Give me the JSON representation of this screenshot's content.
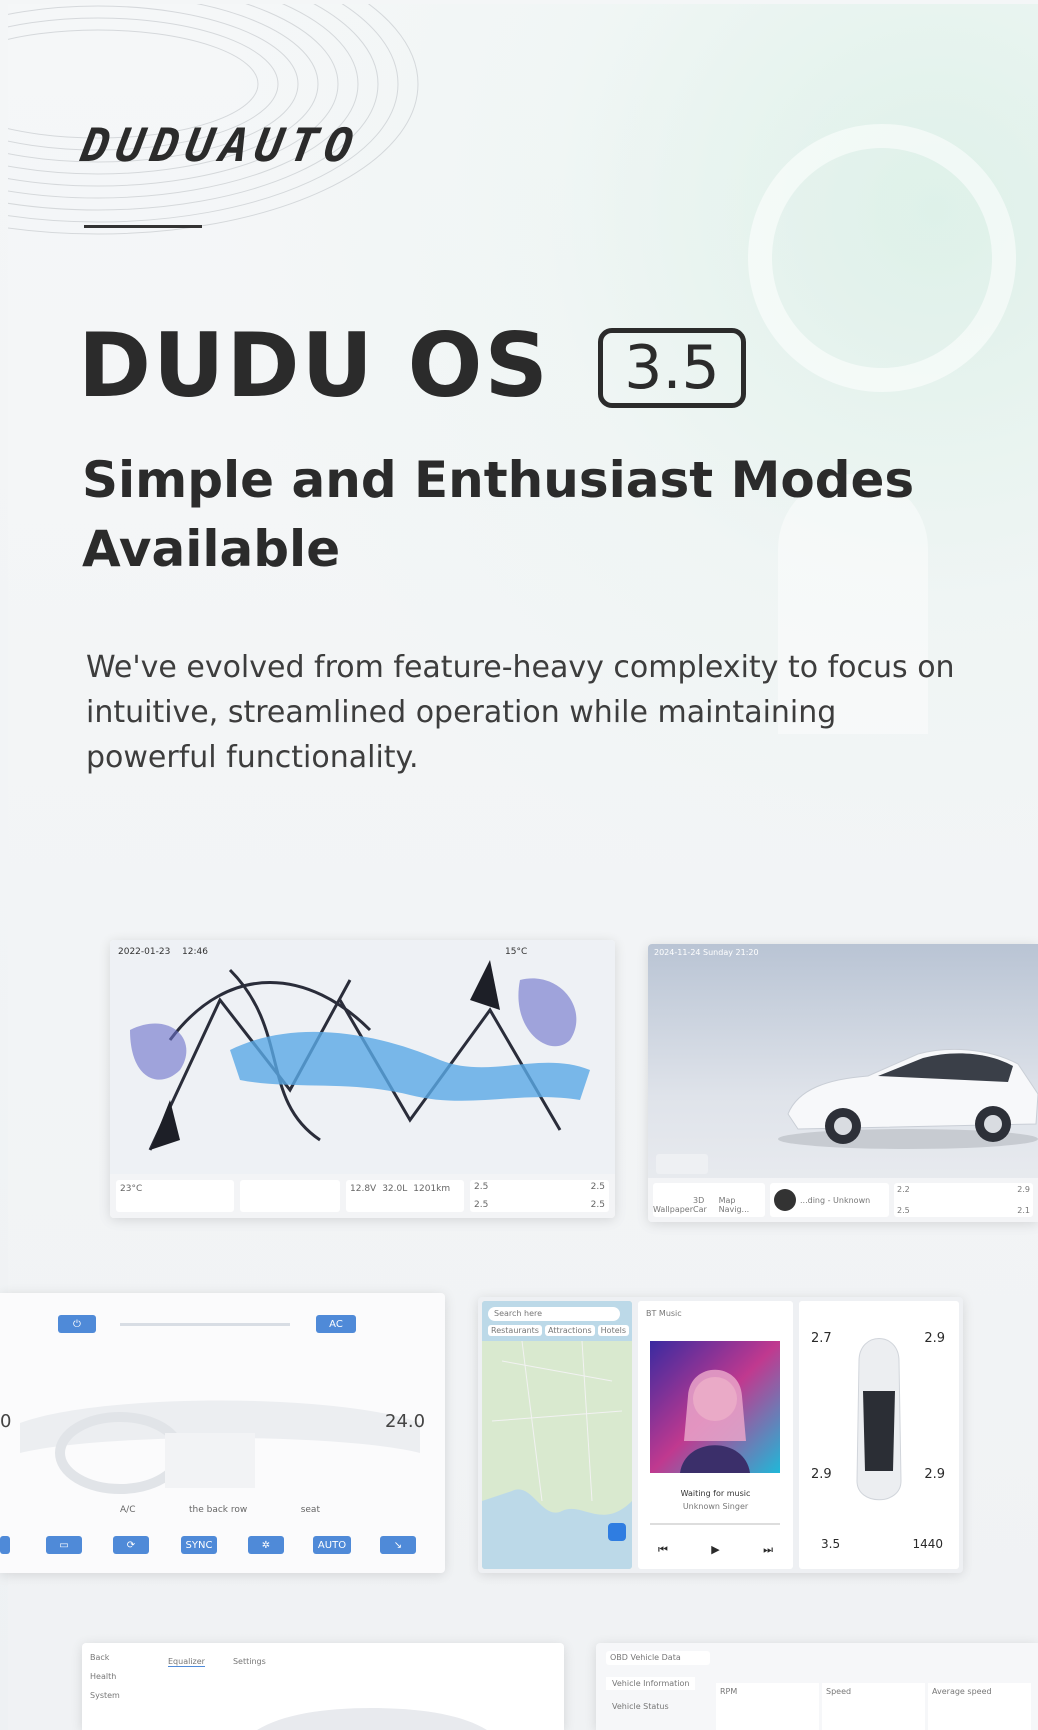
{
  "brand": {
    "logo_text": "DUDUAUTO"
  },
  "hero": {
    "title": "DUDU OS",
    "version": "3.5",
    "subtitle": "Simple and Enthusiast Modes Available",
    "description": "We've evolved from feature-heavy complexity to focus on intuitive, streamlined operation while maintaining powerful functionality."
  },
  "screen1": {
    "date": "2022-01-23",
    "time": "12:46",
    "temp": "15°C",
    "weather": "23°C",
    "voltage": "12.8V",
    "fuel": "32.0L",
    "range": "1201km",
    "tire_fl": "2.5",
    "tire_fr": "2.5",
    "tire_rl": "2.5",
    "tire_rr": "2.5"
  },
  "screen2": {
    "header": "2024-11-24  Sunday  21:20",
    "apps": [
      "Wallpaper",
      "3D Car",
      "Map Navig..."
    ],
    "music": "...ding - Unknown",
    "tire_fl": "2.2",
    "tire_fr": "2.9",
    "tire_rl": "2.5",
    "tire_rr": "2.1"
  },
  "screen3": {
    "ac_label": "AC",
    "temp_right": "24.0",
    "temp_left": "0",
    "features": [
      "A/C",
      "the back row",
      "seat"
    ],
    "buttons": [
      "SYNC",
      "AUTO"
    ]
  },
  "screen4": {
    "search_placeholder": "Search here",
    "map_chips": [
      "Restaurants",
      "Attractions",
      "Hotels"
    ],
    "music_source": "BT Music",
    "song": "Waiting for music",
    "artist": "Unknown Singer",
    "tire_fl": "2.7",
    "tire_fr": "2.9",
    "tire_rl": "2.9",
    "tire_rr": "2.9",
    "voltage": "3.5",
    "range": "1440"
  },
  "screen5": {
    "menu": [
      "Back",
      "Health",
      "System"
    ],
    "tabs": [
      "Equalizer",
      "Settings"
    ]
  },
  "screen6": {
    "dropdown": "OBD Vehicle Data",
    "menu": [
      "Vehicle Information",
      "Vehicle Status"
    ],
    "gauges": [
      "RPM",
      "Speed",
      "Average speed"
    ]
  },
  "colors": {
    "accent": "#4f8ad8",
    "text": "#2b2b2b"
  }
}
